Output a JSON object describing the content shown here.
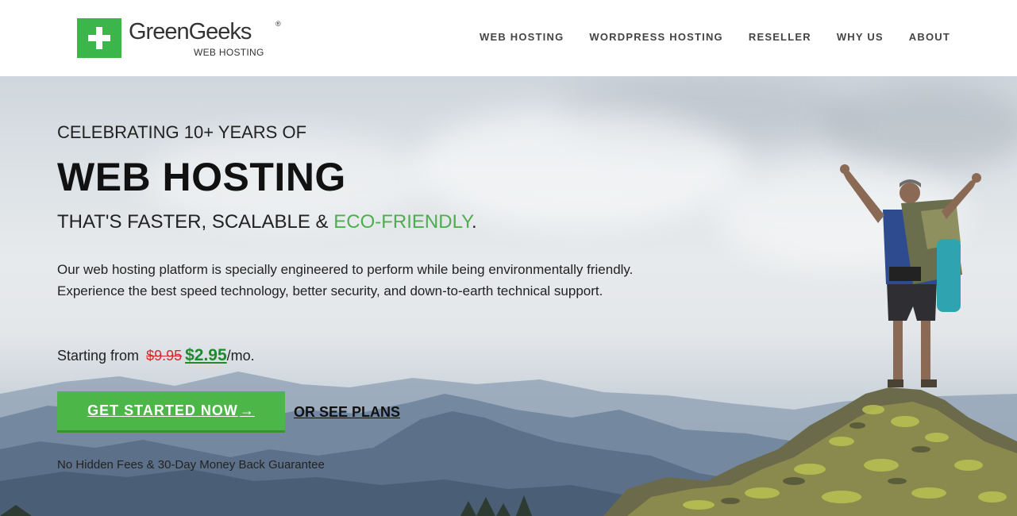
{
  "brand": {
    "name": "GreenGeeks",
    "registered": "®",
    "tagline": "WEB HOSTING",
    "logo_color": "#3cb54a"
  },
  "nav": {
    "items": [
      {
        "label": "WEB HOSTING"
      },
      {
        "label": "WORDPRESS HOSTING"
      },
      {
        "label": "RESELLER"
      },
      {
        "label": "WHY US"
      },
      {
        "label": "ABOUT"
      }
    ]
  },
  "hero": {
    "kicker": "CELEBRATING 10+ YEARS OF",
    "headline": "WEB HOSTING",
    "subline_prefix": "THAT'S FASTER, SCALABLE & ",
    "subline_highlight": "ECO-FRIENDLY",
    "subline_suffix": ".",
    "description": "Our web hosting platform is specially engineered to perform while being environmentally friendly. Experience the best speed technology, better security, and down-to-earth technical support.",
    "price": {
      "prefix": "Starting from",
      "old_price": "$9.95",
      "new_price": "$2.95",
      "suffix": "/mo."
    },
    "cta_label": "GET STARTED NOW",
    "cta_arrow": "→",
    "secondary_link": "OR SEE PLANS",
    "guarantee": "No Hidden Fees & 30-Day Money Back Guarantee"
  },
  "colors": {
    "accent_green": "#4cb748",
    "eco_green": "#4cae4f",
    "old_price_red": "#d9262a",
    "new_price_green": "#1e8a2e"
  }
}
